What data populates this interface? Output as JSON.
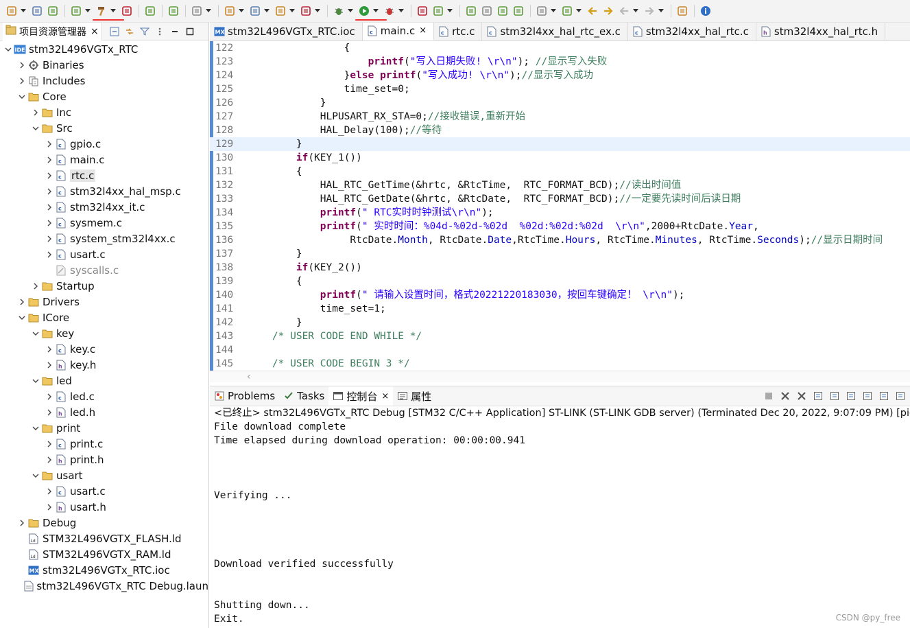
{
  "toolbar": {
    "icons": [
      "new-file-icon",
      "save-icon",
      "save-all-icon",
      "settings-icon",
      "build-hammer-icon",
      "build-target-icon",
      "debug-toggle-icon",
      "refresh-icon",
      "run-external-icon",
      "new-project-icon",
      "open-folder-icon",
      "new-source-icon",
      "new-class-icon",
      "bug-icon",
      "run-icon",
      "debug-run-icon",
      "open-type-icon",
      "wand-icon",
      "edit-icon",
      "format-icon",
      "toggle-icon",
      "pilcrow-icon",
      "nav-down-icon",
      "nav-up-icon",
      "back-edit-icon",
      "forward-edit-icon",
      "back-icon",
      "forward-icon",
      "open-perspective-icon",
      "info-icon"
    ]
  },
  "explorer": {
    "title": "项目资源管理器",
    "nodes": [
      {
        "label": "stm32L496VGTx_RTC",
        "indent": 0,
        "expanded": true,
        "icon": "ide-project-icon"
      },
      {
        "label": "Binaries",
        "indent": 1,
        "expanded": false,
        "icon": "binaries-icon"
      },
      {
        "label": "Includes",
        "indent": 1,
        "expanded": false,
        "icon": "includes-icon"
      },
      {
        "label": "Core",
        "indent": 1,
        "expanded": true,
        "icon": "folder-icon"
      },
      {
        "label": "Inc",
        "indent": 2,
        "expanded": false,
        "icon": "folder-icon"
      },
      {
        "label": "Src",
        "indent": 2,
        "expanded": true,
        "icon": "folder-icon"
      },
      {
        "label": "gpio.c",
        "indent": 3,
        "expanded": false,
        "icon": "c-file-icon"
      },
      {
        "label": "main.c",
        "indent": 3,
        "expanded": false,
        "icon": "c-file-icon"
      },
      {
        "label": "rtc.c",
        "indent": 3,
        "expanded": false,
        "icon": "c-file-icon",
        "selected": true
      },
      {
        "label": "stm32l4xx_hal_msp.c",
        "indent": 3,
        "expanded": false,
        "icon": "c-file-icon"
      },
      {
        "label": "stm32l4xx_it.c",
        "indent": 3,
        "expanded": false,
        "icon": "c-file-icon"
      },
      {
        "label": "sysmem.c",
        "indent": 3,
        "expanded": false,
        "icon": "c-file-icon"
      },
      {
        "label": "system_stm32l4xx.c",
        "indent": 3,
        "expanded": false,
        "icon": "c-file-icon"
      },
      {
        "label": "usart.c",
        "indent": 3,
        "expanded": false,
        "icon": "c-file-icon"
      },
      {
        "label": "syscalls.c",
        "indent": 3,
        "leaf": true,
        "icon": "excluded-file-icon",
        "muted": true
      },
      {
        "label": "Startup",
        "indent": 2,
        "expanded": false,
        "icon": "folder-icon"
      },
      {
        "label": "Drivers",
        "indent": 1,
        "expanded": false,
        "icon": "folder-icon"
      },
      {
        "label": "ICore",
        "indent": 1,
        "expanded": true,
        "icon": "folder-icon"
      },
      {
        "label": "key",
        "indent": 2,
        "expanded": true,
        "icon": "folder-icon"
      },
      {
        "label": "key.c",
        "indent": 3,
        "expanded": false,
        "icon": "c-file-icon"
      },
      {
        "label": "key.h",
        "indent": 3,
        "expanded": false,
        "icon": "h-file-icon"
      },
      {
        "label": "led",
        "indent": 2,
        "expanded": true,
        "icon": "folder-icon"
      },
      {
        "label": "led.c",
        "indent": 3,
        "expanded": false,
        "icon": "c-file-icon"
      },
      {
        "label": "led.h",
        "indent": 3,
        "expanded": false,
        "icon": "h-file-icon"
      },
      {
        "label": "print",
        "indent": 2,
        "expanded": true,
        "icon": "folder-icon"
      },
      {
        "label": "print.c",
        "indent": 3,
        "expanded": false,
        "icon": "c-file-icon"
      },
      {
        "label": "print.h",
        "indent": 3,
        "expanded": false,
        "icon": "h-file-icon"
      },
      {
        "label": "usart",
        "indent": 2,
        "expanded": true,
        "icon": "folder-icon"
      },
      {
        "label": "usart.c",
        "indent": 3,
        "expanded": false,
        "icon": "c-file-icon"
      },
      {
        "label": "usart.h",
        "indent": 3,
        "expanded": false,
        "icon": "h-file-icon"
      },
      {
        "label": "Debug",
        "indent": 1,
        "expanded": false,
        "icon": "folder-icon"
      },
      {
        "label": "STM32L496VGTX_FLASH.ld",
        "indent": 1,
        "leaf": true,
        "icon": "ld-file-icon"
      },
      {
        "label": "STM32L496VGTX_RAM.ld",
        "indent": 1,
        "leaf": true,
        "icon": "ld-file-icon"
      },
      {
        "label": "stm32L496VGTx_RTC.ioc",
        "indent": 1,
        "leaf": true,
        "icon": "mx-file-icon"
      },
      {
        "label": "stm32L496VGTx_RTC Debug.laun",
        "indent": 1,
        "leaf": true,
        "icon": "launch-file-icon"
      }
    ]
  },
  "editor": {
    "tabs": [
      {
        "label": "stm32L496VGTx_RTC.ioc",
        "icon": "mx-file-icon",
        "active": false
      },
      {
        "label": "main.c",
        "icon": "c-file-icon",
        "active": true,
        "close": "×"
      },
      {
        "label": "rtc.c",
        "icon": "c-file-icon",
        "active": false
      },
      {
        "label": "stm32l4xx_hal_rtc_ex.c",
        "icon": "c-file-icon",
        "active": false
      },
      {
        "label": "stm32l4xx_hal_rtc.c",
        "icon": "c-file-icon",
        "active": false
      },
      {
        "label": "stm32l4xx_hal_rtc.h",
        "icon": "h-file-icon",
        "active": false
      }
    ],
    "highlight_line": 129,
    "lines": [
      {
        "n": "122",
        "t": "                {"
      },
      {
        "n": "123",
        "t": "                    printf(\"写入日期失败! \\r\\n\"); //显示写入失败"
      },
      {
        "n": "124",
        "t": "                }else printf(\"写入成功! \\r\\n\");//显示写入成功"
      },
      {
        "n": "125",
        "t": "                time_set=0;"
      },
      {
        "n": "126",
        "t": "            }"
      },
      {
        "n": "127",
        "t": "            HLPUSART_RX_STA=0;//接收错误,重新开始"
      },
      {
        "n": "128",
        "t": "            HAL_Delay(100);//等待"
      },
      {
        "n": "129",
        "t": "        }"
      },
      {
        "n": "130",
        "t": "        if(KEY_1())"
      },
      {
        "n": "131",
        "t": "        {"
      },
      {
        "n": "132",
        "t": "            HAL_RTC_GetTime(&hrtc, &RtcTime,  RTC_FORMAT_BCD);//读出时间值"
      },
      {
        "n": "133",
        "t": "            HAL_RTC_GetDate(&hrtc, &RtcDate,  RTC_FORMAT_BCD);//一定要先读时间后读日期"
      },
      {
        "n": "134",
        "t": "            printf(\" RTC实时时钟测试\\r\\n\");"
      },
      {
        "n": "135",
        "t": "            printf(\" 实时时间：%04d-%02d-%02d  %02d:%02d:%02d  \\r\\n\",2000+RtcDate.Year,"
      },
      {
        "n": "136",
        "t": "                 RtcDate.Month, RtcDate.Date,RtcTime.Hours, RtcTime.Minutes, RtcTime.Seconds);//显示日期时间"
      },
      {
        "n": "137",
        "t": "        }"
      },
      {
        "n": "138",
        "t": "        if(KEY_2())"
      },
      {
        "n": "139",
        "t": "        {"
      },
      {
        "n": "140",
        "t": "            printf(\" 请输入设置时间，格式20221220183030，按回车键确定！ \\r\\n\");"
      },
      {
        "n": "141",
        "t": "            time_set=1;"
      },
      {
        "n": "142",
        "t": "        }"
      },
      {
        "n": "143",
        "t": "    /* USER CODE END WHILE */"
      },
      {
        "n": "144",
        "t": ""
      },
      {
        "n": "145",
        "t": "    /* USER CODE BEGIN 3 */"
      }
    ]
  },
  "console": {
    "tabs": [
      {
        "label": "Problems",
        "icon": "problems-icon",
        "active": false
      },
      {
        "label": "Tasks",
        "icon": "tasks-icon",
        "active": false
      },
      {
        "label": "控制台",
        "icon": "console-icon",
        "active": true,
        "close": "×"
      },
      {
        "label": "属性",
        "icon": "properties-icon",
        "active": false
      }
    ],
    "header": "<已终止> stm32L496VGTx_RTC Debug [STM32 C/C++ Application] ST-LINK (ST-LINK GDB server) (Terminated Dec 20, 2022, 9:07:09 PM) [pid",
    "lines": [
      {
        "row": 0,
        "text": "File download complete"
      },
      {
        "row": 1,
        "text": "Time elapsed during download operation: 00:00:00.941"
      },
      {
        "row": 5,
        "text": "Verifying ..."
      },
      {
        "row": 10,
        "text": "Download verified successfully"
      },
      {
        "row": 13,
        "text": "Shutting down..."
      },
      {
        "row": 14,
        "text": "Exit."
      }
    ]
  },
  "watermark": "CSDN @py_free"
}
